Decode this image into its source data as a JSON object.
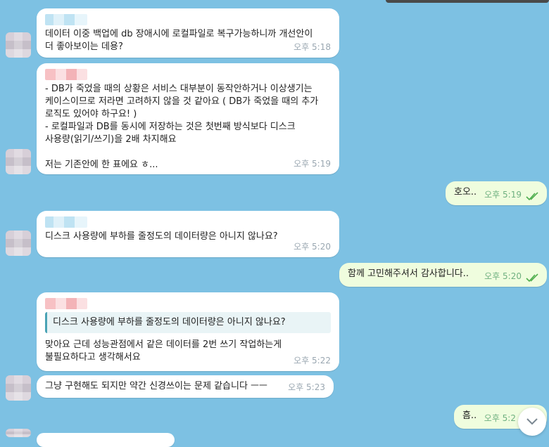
{
  "messages": [
    {
      "text": "데이터 이중 백업에 db 장애시에 로컬파일로 복구가능하니까 개선안이\n더 좋아보이는 데용?",
      "time": "오후 5:18"
    },
    {
      "text": "- DB가 죽었을 때의 상황은 서비스 대부분이 동작안하거나 이상생기는\n케이스이므로 저라면 고려하지 않을 것 같아요 ( DB가 죽었을 때의 추가\n로직도 있어야 하구요! )\n- 로컬파일과 DB를 동시에 저장하는 것은 첫번째 방식보다 디스크\n사용량(읽기/쓰기)을 2배 차지해요\n\n저는 기존안에 한 표에요 ㅎ...",
      "time": "오후 5:19"
    },
    {
      "text": "호오..",
      "time": "오후 5:19"
    },
    {
      "text": "디스크 사용량에 부하를 줄정도의 데이터량은 아니지 않나요?",
      "time": "오후 5:20"
    },
    {
      "text": "함께 고민해주셔서 감사합니다..",
      "time": "오후 5:20"
    },
    {
      "quote": "디스크 사용량에 부하를 줄정도의 데이터량은 아니지 않나요?",
      "text": "맞아요 근데 성능관점에서 같은 데이터를 2번 쓰기 작업하는게\n불필요하다고 생각해서요",
      "time": "오후 5:22"
    },
    {
      "text": "그냥 구현해도 되지만 약간 신경쓰이는 문제 같습니다 ㅡㅡ",
      "time": "오후 5:23"
    },
    {
      "text": "흠..",
      "time": "오후 5:2"
    }
  ],
  "colors": {
    "background": "#7dc1e3",
    "incoming": "#ffffff",
    "outgoing": "#effdde",
    "checks": "#4fae4e"
  },
  "icons": {
    "read_receipt": "double-check-icon",
    "scroll": "chevron-down-icon"
  }
}
